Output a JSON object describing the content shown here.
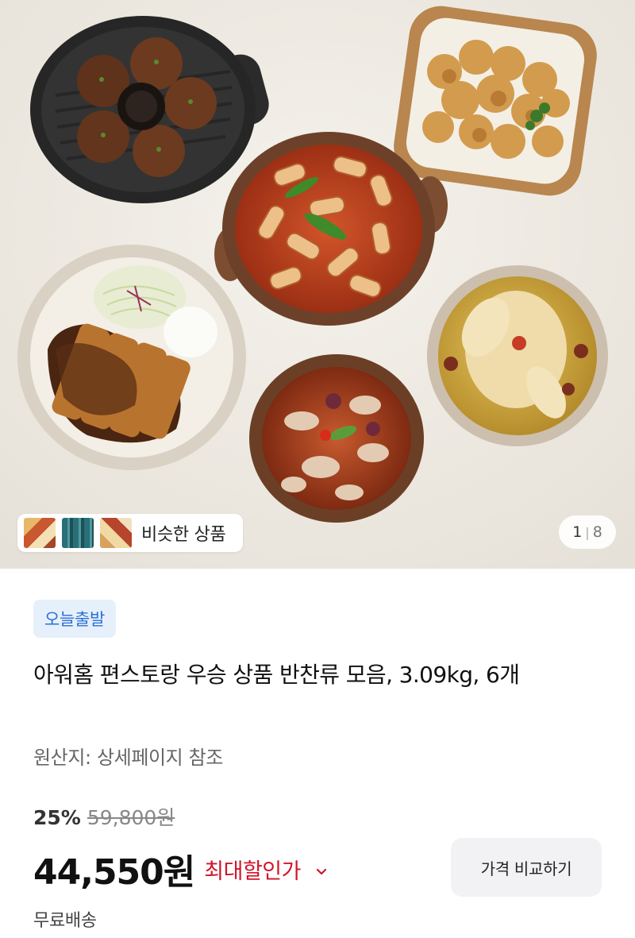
{
  "gallery": {
    "similar_label": "비슷한 상품",
    "page_current": "1",
    "page_total": "8",
    "thumb_icons": [
      "product-thumb-1",
      "product-thumb-2",
      "product-thumb-3"
    ]
  },
  "product": {
    "badge": "오늘출발",
    "title": "아워홈 편스토랑 우승 상품 반찬류 모음, 3.09kg, 6개",
    "origin": "원산지: 상세페이지 참조",
    "discount_rate": "25%",
    "original_price": "59,800원",
    "sale_price": "44,550원",
    "max_discount_label": "최대할인가",
    "compare_button": "가격 비교하기",
    "shipping": "무료배송"
  },
  "colors": {
    "badge_bg": "#e6f0fb",
    "badge_text": "#2a6fd6",
    "accent_red": "#d1152a",
    "button_bg": "#f2f2f4"
  }
}
